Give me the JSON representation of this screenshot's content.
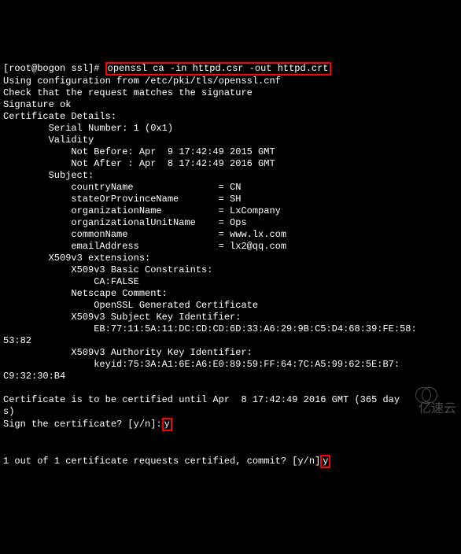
{
  "prompt": {
    "user": "root",
    "host": "bogon",
    "cwd": "ssl",
    "symbol": "#"
  },
  "command": "openssl ca -in httpd.csr -out httpd.crt",
  "config_line": "Using configuration from /etc/pki/tls/openssl.cnf",
  "check_line": "Check that the request matches the signature",
  "sig_ok": "Signature ok",
  "cert_details_header": "Certificate Details:",
  "serial": "Serial Number: 1 (0x1)",
  "validity_label": "Validity",
  "not_before": "Not Before: Apr  9 17:42:49 2015 GMT",
  "not_after": "Not After : Apr  8 17:42:49 2016 GMT",
  "subject_label": "Subject:",
  "subject": {
    "countryName": "CN",
    "stateOrProvinceName": "SH",
    "organizationName": "LxCompany",
    "organizationalUnitName": "Ops",
    "commonName": "www.lx.com",
    "emailAddress": "lx2@qq.com"
  },
  "x509_header": "X509v3 extensions:",
  "basic_constraints_label": "X509v3 Basic Constraints:",
  "basic_constraints_value": "CA:FALSE",
  "netscape_comment_label": "Netscape Comment:",
  "netscape_comment_value": "OpenSSL Generated Certificate",
  "subject_key_id_label": "X509v3 Subject Key Identifier:",
  "subject_key_id_value_part1": "EB:77:11:5A:11:DC:CD:CD:6D:33:A6:29:9B:C5:D4:68:39:FE:58:",
  "subject_key_id_value_part2": "53:82",
  "authority_key_id_label": "X509v3 Authority Key Identifier:",
  "authority_key_id_value_part1": "keyid:75:3A:A1:6E:A6:E0:89:59:FF:64:7C:A5:99:62:5E:B7:",
  "authority_key_id_value_part2": "C9:32:30:B4",
  "certify_until": "Certificate is to be certified until Apr  8 17:42:49 2016 GMT (365 day",
  "certify_until_cont": "s)",
  "sign_prompt": "Sign the certificate? [y/n]:",
  "sign_answer": "y",
  "commit_prompt": "1 out of 1 certificate requests certified, commit? [y/n]",
  "commit_answer": "y",
  "watermark": "亿速云"
}
